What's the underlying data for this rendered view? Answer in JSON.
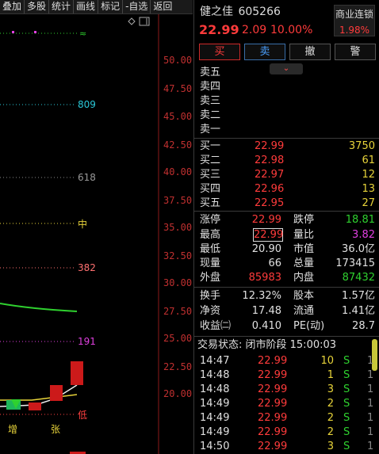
{
  "toolbar": [
    "叠加",
    "多股",
    "统计",
    "画线",
    "标记",
    "-自选",
    "返回"
  ],
  "chart": {
    "price_labels": [
      "50.00",
      "47.50",
      "45.00",
      "42.50",
      "40.00",
      "37.50",
      "35.00",
      "32.50",
      "30.00",
      "27.50",
      "25.00",
      "22.50",
      "20.00"
    ],
    "fib_labels": {
      "f809": "809",
      "f618": "618",
      "mid": "中",
      "f382": "382",
      "f191": "191",
      "low": "低"
    },
    "markers": {
      "zeng": "增",
      "zhang": "张"
    }
  },
  "stock": {
    "name": "健之佳",
    "code": "605266",
    "price": "22.99",
    "change": "2.09",
    "change_pct": "10.00%",
    "sector_name": "商业连锁",
    "sector_pct": "1.98%"
  },
  "buttons": {
    "buy": "买",
    "sell": "卖",
    "cancel": "撤",
    "alert": "警"
  },
  "sell_orders": [
    {
      "label": "卖五",
      "price": "",
      "vol": ""
    },
    {
      "label": "卖四",
      "price": "",
      "vol": ""
    },
    {
      "label": "卖三",
      "price": "",
      "vol": ""
    },
    {
      "label": "卖二",
      "price": "",
      "vol": ""
    },
    {
      "label": "卖一",
      "price": "",
      "vol": ""
    }
  ],
  "buy_orders": [
    {
      "label": "买一",
      "price": "22.99",
      "vol": "3750"
    },
    {
      "label": "买二",
      "price": "22.98",
      "vol": "61"
    },
    {
      "label": "买三",
      "price": "22.97",
      "vol": "12"
    },
    {
      "label": "买四",
      "price": "22.96",
      "vol": "13"
    },
    {
      "label": "买五",
      "price": "22.95",
      "vol": "27"
    }
  ],
  "stats": {
    "zt_label": "涨停",
    "zt": "22.99",
    "dt_label": "跌停",
    "dt": "18.81",
    "high_label": "最高",
    "high": "22.99",
    "lb_label": "量比",
    "lb": "3.82",
    "low_label": "最低",
    "low": "20.90",
    "mv_label": "市值",
    "mv": "36.0亿",
    "cur_label": "现量",
    "cur": "66",
    "tv_label": "总量",
    "tv": "173415",
    "out_label": "外盘",
    "out": "85983",
    "in_label": "内盘",
    "in": "87432",
    "hs_label": "换手",
    "hs": "12.32%",
    "gb_label": "股本",
    "gb": "1.57亿",
    "jz_label": "净资",
    "jz": "17.48",
    "lt_label": "流通",
    "lt": "1.41亿",
    "sy_label": "收益㈡",
    "sy": "0.410",
    "pe_label": "PE(动)",
    "pe": "28.7"
  },
  "trade_status": "交易状态: 闭市阶段 15:00:03",
  "ticks": [
    {
      "time": "14:47",
      "price": "22.99",
      "vol": "10",
      "bs": "S",
      "n": "1"
    },
    {
      "time": "14:48",
      "price": "22.99",
      "vol": "1",
      "bs": "S",
      "n": "1"
    },
    {
      "time": "14:48",
      "price": "22.99",
      "vol": "3",
      "bs": "S",
      "n": "1"
    },
    {
      "time": "14:49",
      "price": "22.99",
      "vol": "2",
      "bs": "S",
      "n": "1"
    },
    {
      "time": "14:49",
      "price": "22.99",
      "vol": "2",
      "bs": "S",
      "n": "1"
    },
    {
      "time": "14:49",
      "price": "22.99",
      "vol": "2",
      "bs": "S",
      "n": "1"
    },
    {
      "time": "14:50",
      "price": "22.99",
      "vol": "3",
      "bs": "S",
      "n": "1"
    }
  ]
}
